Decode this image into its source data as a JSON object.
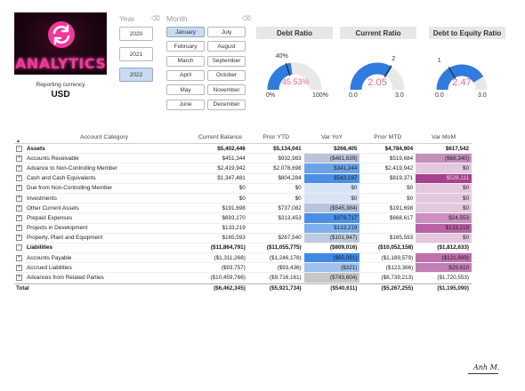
{
  "brand": {
    "logo_text": "ANALYTICS",
    "accent": "#f2399a"
  },
  "currency": {
    "label": "Reporting currency",
    "value": "USD"
  },
  "year_slicer": {
    "title": "Year",
    "items": [
      {
        "label": "2020",
        "selected": false
      },
      {
        "label": "2021",
        "selected": false
      },
      {
        "label": "2022",
        "selected": true
      }
    ]
  },
  "month_slicer": {
    "title": "Month",
    "items": [
      {
        "label": "January",
        "selected": true
      },
      {
        "label": "July",
        "selected": false
      },
      {
        "label": "February",
        "selected": false
      },
      {
        "label": "August",
        "selected": false
      },
      {
        "label": "March",
        "selected": false
      },
      {
        "label": "September",
        "selected": false
      },
      {
        "label": "April",
        "selected": false
      },
      {
        "label": "October",
        "selected": false
      },
      {
        "label": "May",
        "selected": false
      },
      {
        "label": "November",
        "selected": false
      },
      {
        "label": "June",
        "selected": false
      },
      {
        "label": "December",
        "selected": false
      }
    ]
  },
  "kpis": [
    {
      "title": "Debt Ratio",
      "value": "45.53%",
      "target": "40%",
      "min": "0%",
      "max": "100%",
      "fraction": 0.4553,
      "target_fraction": 0.4
    },
    {
      "title": "Current Ratio",
      "value": "2.05",
      "target": "2",
      "min": "0.0",
      "max": "3.0",
      "fraction": 0.6833,
      "target_fraction": 0.6667
    },
    {
      "title": "Debt to Equity Ratio",
      "value": "2.47",
      "target": "1",
      "min": "0.0",
      "max": "3.0",
      "fraction": 0.8233,
      "target_fraction": 0.3333
    }
  ],
  "table": {
    "columns": [
      "Account Category",
      "Current Balance",
      "Prior YTD",
      "Var YoY",
      "Prior MTD",
      "Var MoM"
    ],
    "rows": [
      {
        "type": "group",
        "name": "Assets",
        "values": [
          "$5,402,446",
          "$5,134,041",
          "$268,405",
          "$4,784,904",
          "$617,542"
        ]
      },
      {
        "type": "item",
        "name": "Accounts Receivable",
        "values": [
          "$451,344",
          "$932,983",
          "($481,639)",
          "$519,684",
          "($68,340)"
        ]
      },
      {
        "type": "item",
        "name": "Advance to Non-Controlling Member",
        "values": [
          "$2,419,942",
          "$2,078,698",
          "$341,244",
          "$2,419,942",
          "$0"
        ]
      },
      {
        "type": "item",
        "name": "Cash and Cash Equivalents",
        "values": [
          "$1,347,481",
          "$804,284",
          "$543,197",
          "$819,371",
          "$528,111"
        ]
      },
      {
        "type": "item",
        "name": "Due from Non-Controlling Member",
        "values": [
          "$0",
          "$0",
          "$0",
          "$0",
          "$0"
        ]
      },
      {
        "type": "item",
        "name": "Investments",
        "values": [
          "$0",
          "$0",
          "$0",
          "$0",
          "$0"
        ]
      },
      {
        "type": "item",
        "name": "Other Current Assets",
        "values": [
          "$191,698",
          "$737,082",
          "($545,384)",
          "$191,698",
          "$0"
        ]
      },
      {
        "type": "item",
        "name": "Prepaid Expenses",
        "values": [
          "$693,170",
          "$313,453",
          "$379,717",
          "$668,617",
          "$24,553"
        ]
      },
      {
        "type": "item",
        "name": "Projects in Development",
        "values": [
          "$133,219",
          "",
          "$133,219",
          "",
          "$133,219"
        ]
      },
      {
        "type": "item",
        "name": "Property, Plant and Equipment",
        "values": [
          "$165,593",
          "$267,540",
          "($101,947)",
          "$165,593",
          "$0"
        ]
      },
      {
        "type": "group",
        "name": "Liabilities",
        "values": [
          "($11,864,791)",
          "($11,055,775)",
          "($809,016)",
          "($10,052,158)",
          "($1,812,633)"
        ]
      },
      {
        "type": "item",
        "name": "Accounts Payable",
        "values": [
          "($1,311,268)",
          "($1,246,178)",
          "($65,091)",
          "($1,189,579)",
          "($121,689)"
        ]
      },
      {
        "type": "item",
        "name": "Accrued Liabilities",
        "values": [
          "($93,757)",
          "($93,436)",
          "($321)",
          "($123,366)",
          "$29,610"
        ]
      },
      {
        "type": "item",
        "name": "Advances from Related Parties",
        "values": [
          "($10,459,766)",
          "($9,716,161)",
          "($743,604)",
          "($8,739,213)",
          "($1,720,553)"
        ]
      },
      {
        "type": "total",
        "name": "Total",
        "values": [
          "($6,462,345)",
          "($5,921,734)",
          "($540,611)",
          "($5,267,255)",
          "($1,195,090)"
        ]
      }
    ],
    "var_yoy_colors": [
      "",
      "#b8c4dc",
      "#6aa2e8",
      "#4a8fe6",
      "#d8e4f6",
      "#d8e4f6",
      "#b8c4dc",
      "#4a8fe6",
      "#7eb0ec",
      "#c0cade",
      "",
      "#3f88e6",
      "#9fc1ef",
      "#c7c7c7",
      ""
    ],
    "var_mom_colors": [
      "",
      "#c58fba",
      "#e4c8de",
      "#a8408f",
      "#e4c8de",
      "#e4c8de",
      "#e4c8de",
      "#cc8fc0",
      "#b863a6",
      "#e4c8de",
      "",
      "#bf70ad",
      "#c27fb4",
      "",
      ""
    ]
  },
  "signature": "Anh M."
}
